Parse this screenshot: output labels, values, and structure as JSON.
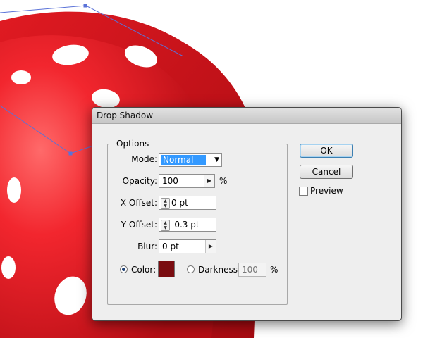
{
  "background": {
    "die_color": "#d6131c",
    "pip_color": "#ffffff",
    "path_color": "#5a72d8"
  },
  "dialog": {
    "title": "Drop Shadow",
    "options_legend": "Options",
    "mode": {
      "label": "Mode:",
      "value": "Normal"
    },
    "opacity": {
      "label": "Opacity:",
      "value": "100",
      "unit": "%"
    },
    "x_offset": {
      "label": "X Offset:",
      "value": "0 pt"
    },
    "y_offset": {
      "label": "Y Offset:",
      "value": "-0.3 pt"
    },
    "blur": {
      "label": "Blur:",
      "value": "0 pt"
    },
    "color": {
      "label": "Color:",
      "swatch": "#7a0c10",
      "selected": true
    },
    "darkness": {
      "label": "Darkness:",
      "value": "100",
      "unit": "%"
    },
    "ok_label": "OK",
    "cancel_label": "Cancel",
    "preview_label": "Preview"
  }
}
